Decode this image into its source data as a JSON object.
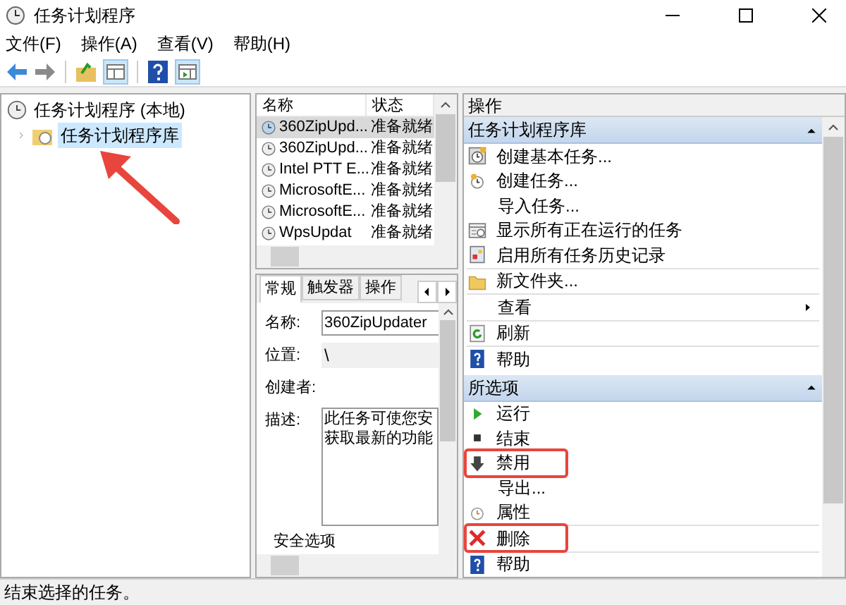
{
  "window": {
    "title": "任务计划程序"
  },
  "menu": [
    "文件(F)",
    "操作(A)",
    "查看(V)",
    "帮助(H)"
  ],
  "tree": [
    {
      "label": "任务计划程序 (本地)",
      "selected": false,
      "children": [
        {
          "label": "任务计划程序库",
          "selected": true
        }
      ]
    }
  ],
  "task_list": {
    "columns": [
      "名称",
      "状态"
    ],
    "rows": [
      {
        "name": "360ZipUpd...",
        "status": "准备就绪",
        "selected": true
      },
      {
        "name": "360ZipUpd...",
        "status": "准备就绪",
        "selected": false
      },
      {
        "name": "Intel PTT E...",
        "status": "准备就绪",
        "selected": false
      },
      {
        "name": "MicrosoftE...",
        "status": "准备就绪",
        "selected": false
      },
      {
        "name": "MicrosoftE...",
        "status": "准备就绪",
        "selected": false
      },
      {
        "name": "WpsUpdat",
        "status": "准备就绪",
        "selected": false
      }
    ]
  },
  "details": {
    "tabs": [
      {
        "label": "常规",
        "selected": true
      },
      {
        "label": "触发器",
        "selected": false
      },
      {
        "label": "操作",
        "selected": false
      }
    ],
    "fields": [
      {
        "label": "名称:",
        "kind": "input",
        "value": "360ZipUpdater"
      },
      {
        "label": "位置:",
        "kind": "text",
        "value": "\\"
      },
      {
        "label": "创建者:",
        "kind": "text"
      },
      {
        "label": "描述:",
        "kind": "textarea",
        "lines": [
          "此任务可使您安",
          "获取最新的功能"
        ]
      }
    ],
    "section": "安全选项"
  },
  "actions": {
    "title": "操作",
    "sections": [
      {
        "title": "任务计划程序库",
        "items": [
          {
            "label": "创建基本任务...",
            "kind": "basic-task"
          },
          {
            "label": "创建任务...",
            "kind": "task"
          },
          {
            "label": "导入任务...",
            "kind": "plain"
          },
          {
            "label": "显示所有正在运行的任务",
            "kind": "running"
          },
          {
            "label": "启用所有任务历史记录",
            "kind": "history"
          },
          {
            "label": "新文件夹...",
            "kind": "folder",
            "divider_before": true
          },
          {
            "label": "查看",
            "kind": "plain",
            "submenu": true,
            "divider_before": true
          },
          {
            "label": "刷新",
            "kind": "refresh",
            "divider_before": true
          },
          {
            "label": "帮助",
            "kind": "help",
            "divider_before": true
          }
        ]
      },
      {
        "title": "所选项",
        "items": [
          {
            "label": "运行",
            "kind": "run"
          },
          {
            "label": "结束",
            "kind": "stop"
          },
          {
            "label": "禁用",
            "kind": "disable",
            "highlighted": true
          },
          {
            "label": "导出...",
            "kind": "plain"
          },
          {
            "label": "属性",
            "kind": "properties"
          },
          {
            "label": "删除",
            "kind": "delete",
            "highlighted": true,
            "divider_before": true
          },
          {
            "label": "帮助",
            "kind": "help",
            "divider_before": true
          }
        ]
      }
    ]
  },
  "status_bar": "结束选择的任务。"
}
